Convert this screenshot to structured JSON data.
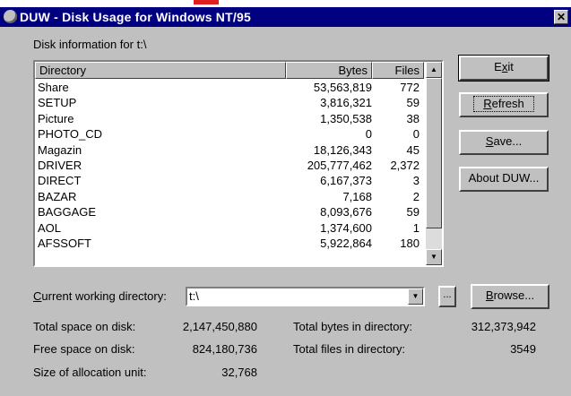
{
  "window": {
    "title": "DUW - Disk Usage for Windows NT/95",
    "close_glyph": "✕"
  },
  "disk_info_label": "Disk information for t:\\",
  "table": {
    "headers": {
      "directory": "Directory",
      "bytes": "Bytes",
      "files": "Files"
    },
    "rows": [
      {
        "name": "Share",
        "bytes": "53,563,819",
        "files": "772"
      },
      {
        "name": "SETUP",
        "bytes": "3,816,321",
        "files": "59"
      },
      {
        "name": "Picture",
        "bytes": "1,350,538",
        "files": "38"
      },
      {
        "name": "PHOTO_CD",
        "bytes": "0",
        "files": "0"
      },
      {
        "name": "Magazin",
        "bytes": "18,126,343",
        "files": "45"
      },
      {
        "name": "DRIVER",
        "bytes": "205,777,462",
        "files": "2,372"
      },
      {
        "name": "DIRECT",
        "bytes": "6,167,373",
        "files": "3"
      },
      {
        "name": "BAZAR",
        "bytes": "7,168",
        "files": "2"
      },
      {
        "name": "BAGGAGE",
        "bytes": "8,093,676",
        "files": "59"
      },
      {
        "name": "AOL",
        "bytes": "1,374,600",
        "files": "1"
      },
      {
        "name": "AFSSOFT",
        "bytes": "5,922,864",
        "files": "180"
      }
    ]
  },
  "buttons": {
    "exit_pre": "E",
    "exit_u": "x",
    "exit_post": "it",
    "refresh_u": "R",
    "refresh_post": "efresh",
    "save_u": "S",
    "save_post": "ave...",
    "about": "About DUW...",
    "ellipsis": "...",
    "browse_u": "B",
    "browse_post": "rowse..."
  },
  "cwd": {
    "label_u": "C",
    "label_post": "urrent working directory:",
    "value": "t:\\"
  },
  "stats": {
    "total_space_label": "Total space on disk:",
    "total_space": "2,147,450,880",
    "free_space_label": "Free space on disk:",
    "free_space": "824,180,736",
    "alloc_label": "Size of allocation unit:",
    "alloc": "32,768",
    "total_bytes_label": "Total bytes in directory:",
    "total_bytes": "312,373,942",
    "total_files_label": "Total files in directory:",
    "total_files": "3549"
  },
  "icons": {
    "scroll_up": "▲",
    "scroll_down": "▼",
    "dropdown": "▼"
  },
  "colors": {
    "titlebar": "#000080",
    "face": "#c0c0c0",
    "accent_mark": "#e02020"
  }
}
